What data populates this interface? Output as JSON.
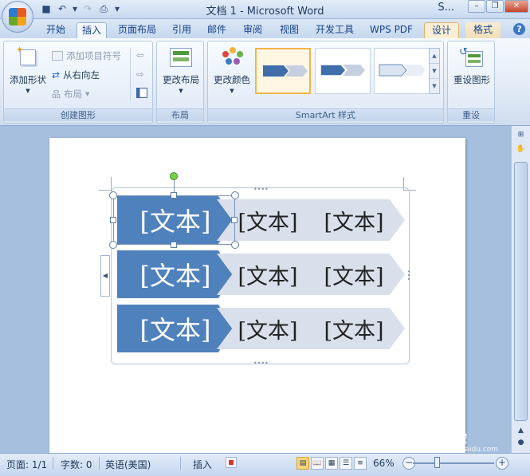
{
  "window": {
    "title": "文档 1 - Microsoft Word",
    "title_suffix": "S..."
  },
  "ribbon_tabs": [
    {
      "label": "开始"
    },
    {
      "label": "插入"
    },
    {
      "label": "页面布局"
    },
    {
      "label": "引用"
    },
    {
      "label": "邮件"
    },
    {
      "label": "审阅"
    },
    {
      "label": "视图"
    },
    {
      "label": "开发工具"
    },
    {
      "label": "WPS PDF"
    },
    {
      "label": "设计"
    },
    {
      "label": "格式"
    }
  ],
  "groups": {
    "create": {
      "label": "创建图形",
      "add_shape": "添加形状",
      "add_bullet": "添加项目符号",
      "right_to_left": "从右向左",
      "layout": "布局"
    },
    "layout": {
      "label": "布局",
      "change_layout": "更改布局"
    },
    "styles": {
      "label": "SmartArt 样式",
      "change_colors": "更改颜色"
    },
    "reset": {
      "label": "重设",
      "reset_graphic": "重设图形"
    }
  },
  "smartart": {
    "rows": [
      [
        "[文本]",
        "[文本]",
        "[文本]"
      ],
      [
        "[文本]",
        "[文本]",
        "[文本]"
      ],
      [
        "[文本]",
        "[文本]",
        "[文本]"
      ]
    ],
    "accent_color": "#4f81bd",
    "light_color": "#d9e0ec"
  },
  "statusbar": {
    "page": "页面: 1/1",
    "words": "字数: 0",
    "language": "英语(美国)",
    "insert_mode": "插入",
    "zoom": "66%"
  },
  "watermark": {
    "text": "Bai 经验",
    "sub": "jingyan.baidu.com"
  }
}
